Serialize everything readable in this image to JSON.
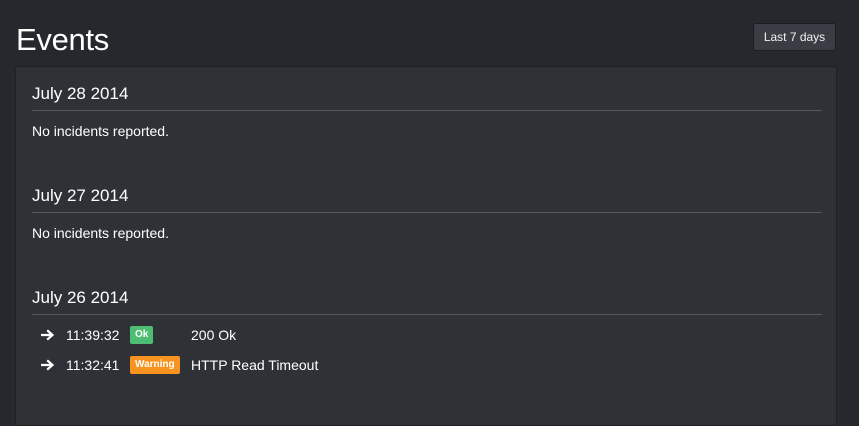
{
  "header": {
    "title": "Events",
    "range_button_label": "Last 7 days"
  },
  "days": [
    {
      "date": "July 28 2014",
      "note": "No incidents reported."
    },
    {
      "date": "July 27 2014",
      "note": "No incidents reported."
    },
    {
      "date": "July 26 2014",
      "events": [
        {
          "time": "11:39:32",
          "status": "Ok",
          "status_color": "#4dbd74",
          "message": "200 Ok",
          "icon": "arrow-right-icon"
        },
        {
          "time": "11:32:41",
          "status": "Warning",
          "status_color": "#f7931e",
          "message": "HTTP Read Timeout",
          "icon": "arrow-right-icon"
        }
      ]
    }
  ],
  "colors": {
    "page_background": "#25282c",
    "panel_background": "#2e3236",
    "divider": "#55595f",
    "text": "#ffffff"
  }
}
